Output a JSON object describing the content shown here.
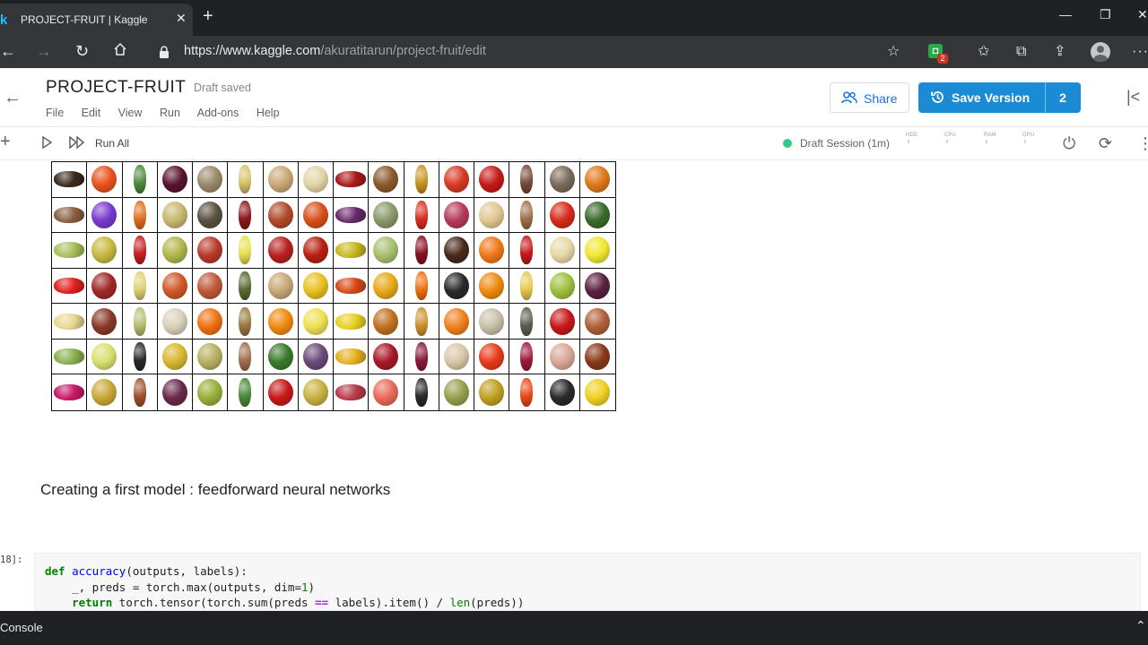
{
  "browser": {
    "tab_title": "PROJECT-FRUIT | Kaggle",
    "tab_favicon": "k",
    "new_tab": "+",
    "url_host": "https://www.kaggle.com",
    "url_path": "/akuratitarun/project-fruit/edit",
    "extension_badge": "2"
  },
  "header": {
    "title": "PROJECT-FRUIT",
    "status": "Draft saved",
    "menu": [
      "File",
      "Edit",
      "View",
      "Run",
      "Add-ons",
      "Help"
    ],
    "share_label": "Share",
    "save_label": "Save Version",
    "save_count": "2"
  },
  "toolbar": {
    "run_all": "Run All",
    "session": "Draft Session (1m)",
    "meters": [
      "HDD",
      "CPU",
      "RAM",
      "GPU"
    ]
  },
  "notebook": {
    "fruit_grid": {
      "columns": 16,
      "rows": 7,
      "colors": [
        "#3a2a20",
        "#e8521c",
        "#4f8a3c",
        "#5a1230",
        "#9a8a6a",
        "#d9c26a",
        "#caa878",
        "#e2d6a6",
        "#a81818",
        "#8a5a2a",
        "#c8961e",
        "#d83a22",
        "#c81818",
        "#7a4a3a",
        "#7a6a5a",
        "#e07818",
        "#8a6040",
        "#7a3ad0",
        "#e0701e",
        "#c8b870",
        "#5a5040",
        "#8a1818",
        "#b04a2a",
        "#d8501a",
        "#6a2a6a",
        "#8a9a6a",
        "#d83020",
        "#b83a5a",
        "#e2c890",
        "#a0704a",
        "#d82a1a",
        "#3a6a2a",
        "#a8c05a",
        "#c8b840",
        "#c81e1e",
        "#b0b84a",
        "#b83a2a",
        "#e8e050",
        "#b82020",
        "#b82010",
        "#c8b820",
        "#a8c070",
        "#8a1020",
        "#4a2818",
        "#f07818",
        "#c81818",
        "#e8d8a8",
        "#f0e830",
        "#e02020",
        "#a02828",
        "#e0d070",
        "#d05828",
        "#c05838",
        "#5a6a30",
        "#c8a878",
        "#e8c020",
        "#d84818",
        "#e8a818",
        "#f07010",
        "#2a2a2a",
        "#f08a10",
        "#e8c850",
        "#a0c040",
        "#5a2040",
        "#e8d890",
        "#8a3828",
        "#b8c070",
        "#d8d0b8",
        "#f07010",
        "#9a7a40",
        "#f08a10",
        "#f0e050",
        "#e8d020",
        "#c07020",
        "#d09030",
        "#f08020",
        "#c8c0a8",
        "#5a6050",
        "#c81818",
        "#b0603a",
        "#8ab050",
        "#d8e070",
        "#2a2a2a",
        "#d8b830",
        "#b8b060",
        "#a07050",
        "#3a7a2a",
        "#6a4a7a",
        "#e8b020",
        "#a81828",
        "#8a1a3a",
        "#d8c8a8",
        "#e83a1a",
        "#a01a3a",
        "#d8a898",
        "#8a3818",
        "#c8186a",
        "#c8a838",
        "#a05030",
        "#6a2a4a",
        "#98b038",
        "#4a8a3a",
        "#c81818",
        "#c8b040",
        "#b83a4a",
        "#e86a5a",
        "#2a2a2a",
        "#98a050",
        "#c0a020",
        "#e84a18",
        "#2a2a2a",
        "#f0d020"
      ]
    },
    "section_title": "Creating a first model : feedforward neural networks",
    "cell_label": "18]:",
    "code_lines": [
      "def accuracy(outputs, labels):",
      "    _, preds = torch.max(outputs, dim=1)",
      "    return torch.tensor(torch.sum(preds == labels).item() / len(preds))"
    ]
  },
  "console": {
    "label": "Console"
  }
}
